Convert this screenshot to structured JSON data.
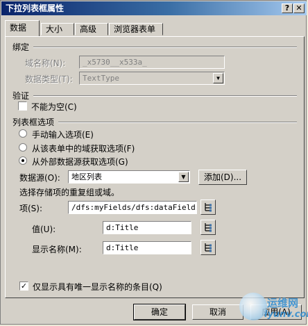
{
  "window": {
    "title": "下拉列表框属性",
    "help_btn": "?",
    "close_btn": "✕"
  },
  "tabs": [
    {
      "label": "数据",
      "active": true
    },
    {
      "label": "大小",
      "active": false
    },
    {
      "label": "高级",
      "active": false
    },
    {
      "label": "浏览器表单",
      "active": false
    }
  ],
  "binding": {
    "section_label": "绑定",
    "field_name_label": "域名称(N):",
    "field_name_value": "_x5730__x533a_",
    "data_type_label": "数据类型(T):",
    "data_type_value": "TextType"
  },
  "validation": {
    "section_label": "验证",
    "not_empty_label": "不能为空(C)",
    "not_empty_checked": false
  },
  "list_options": {
    "section_label": "列表框选项",
    "radio_manual": "手动输入选项(E)",
    "radio_form": "从该表单中的域获取选项(F)",
    "radio_external": "从外部数据源获取选项(G)",
    "selected": "external",
    "datasource_label": "数据源(O):",
    "datasource_value": "地区列表",
    "add_button": "添加(D)...",
    "hint": "选择存储项的重复组或域。",
    "entries_label": "项(S):",
    "entries_value": "/dfs:myFields/dfs:dataFields/",
    "value_label": "值(U):",
    "value_value": "d:Title",
    "display_label": "显示名称(M):",
    "display_value": "d:Title",
    "unique_label": "仅显示具有唯一显示名称的条目(Q)",
    "unique_checked": true
  },
  "footer": {
    "ok": "确定",
    "cancel": "取消",
    "apply": "应用(A)"
  },
  "watermark": {
    "brand": "运维网",
    "url": "iyunv.com"
  },
  "colors": {
    "title_start": "#0a246a",
    "title_end": "#a6caf0",
    "dialog_bg": "#d4d0c8"
  }
}
